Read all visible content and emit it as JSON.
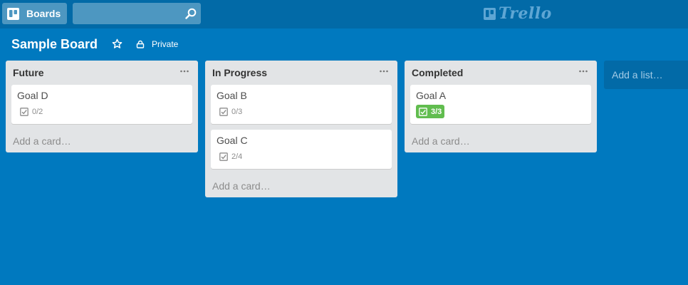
{
  "header": {
    "boards_label": "Boards",
    "search": {
      "value": "",
      "placeholder": ""
    },
    "logo_text": "Trello"
  },
  "board": {
    "title": "Sample Board",
    "privacy_label": "Private"
  },
  "lists": [
    {
      "title": "Future",
      "cards": [
        {
          "title": "Goal D",
          "checklist": "0/2",
          "complete": false
        }
      ],
      "add_card_label": "Add a card…"
    },
    {
      "title": "In Progress",
      "cards": [
        {
          "title": "Goal B",
          "checklist": "0/3",
          "complete": false
        },
        {
          "title": "Goal C",
          "checklist": "2/4",
          "complete": false
        }
      ],
      "add_card_label": "Add a card…"
    },
    {
      "title": "Completed",
      "cards": [
        {
          "title": "Goal A",
          "checklist": "3/3",
          "complete": true
        }
      ],
      "add_card_label": "Add a card…"
    }
  ],
  "add_list_label": "Add a list…",
  "colors": {
    "board_bg": "#0079bf",
    "header_bg": "#026aa7",
    "list_bg": "#e2e4e6",
    "badge_complete": "#61bd4f"
  },
  "icons": {
    "boards": "boards-icon",
    "search": "search-icon",
    "star": "star-icon",
    "private": "lock-icon",
    "list_menu": "more-icon",
    "checklist": "checklist-icon"
  }
}
